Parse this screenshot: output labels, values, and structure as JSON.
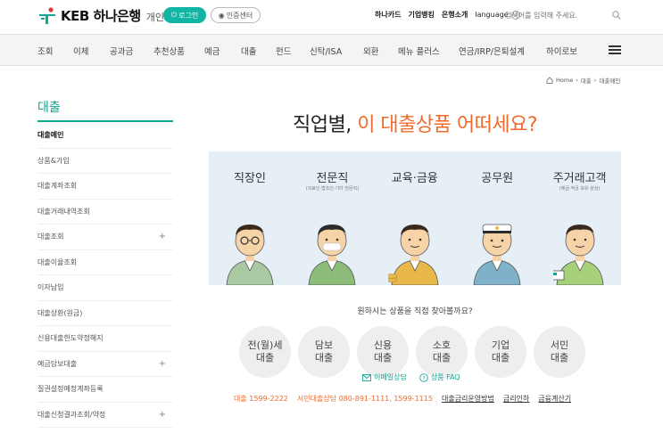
{
  "header": {
    "logo_text": "KEB 하나은행",
    "logo_sub": "개인",
    "login_label": "로그인",
    "cert_label": "인증센터",
    "util_links": [
      "하나카드",
      "기업뱅킹",
      "은행소개"
    ],
    "language_label": "language",
    "search_placeholder": "검색어를 입력해 주세요."
  },
  "nav": {
    "items": [
      "조회",
      "이체",
      "공과금",
      "추천상품",
      "예금",
      "대출",
      "펀드",
      "신탁/ISA",
      "외환",
      "메뉴 플러스",
      "연금/IRP/은퇴설계",
      "하이로보"
    ]
  },
  "breadcrumb": [
    "Home",
    "대출",
    "대출메인"
  ],
  "sidebar": {
    "title": "대출",
    "items": [
      {
        "label": "대출메인",
        "active": true,
        "expand": false
      },
      {
        "label": "상품&가입",
        "active": false,
        "expand": false
      },
      {
        "label": "대출계좌조회",
        "active": false,
        "expand": false
      },
      {
        "label": "대출거래내역조회",
        "active": false,
        "expand": false
      },
      {
        "label": "대출조회",
        "active": false,
        "expand": true
      },
      {
        "label": "대출이율조회",
        "active": false,
        "expand": false
      },
      {
        "label": "이자납입",
        "active": false,
        "expand": false
      },
      {
        "label": "대출상환(원금)",
        "active": false,
        "expand": false
      },
      {
        "label": "신용대출한도약정해지",
        "active": false,
        "expand": false
      },
      {
        "label": "예금담보대출",
        "active": false,
        "expand": true
      },
      {
        "label": "질권설정예정계좌등록",
        "active": false,
        "expand": false
      },
      {
        "label": "대출신청결과조회/약정",
        "active": false,
        "expand": true
      }
    ]
  },
  "main": {
    "headline_prefix": "직업별,",
    "headline_accent": "이 대출상품 어떠세요?",
    "personas": [
      {
        "name": "직장인",
        "sub": ""
      },
      {
        "name": "전문직",
        "sub": "(의료인·법조인·기타 전문직)"
      },
      {
        "name": "교육·금융",
        "sub": ""
      },
      {
        "name": "공무원",
        "sub": ""
      },
      {
        "name": "주거래고객",
        "sub": "(예금·적금 보유 관심)"
      }
    ],
    "question": "원하시는 상품을 직접 찾아볼까요?",
    "categories": [
      {
        "line1": "전(월)세",
        "line2": "대출"
      },
      {
        "line1": "담보",
        "line2": "대출"
      },
      {
        "line1": "신용",
        "line2": "대출"
      },
      {
        "line1": "소호",
        "line2": "대출"
      },
      {
        "line1": "기업",
        "line2": "대출"
      },
      {
        "line1": "서민",
        "line2": "대출"
      }
    ],
    "email_consult": "이메일상담",
    "faq": "상품 FAQ",
    "contact_loan": "대출 1599-2222",
    "contact_seomin": "서민대출상담 080-891-1111, 1599-1115",
    "contact_links": [
      "대출금리운영방법",
      "금리인하",
      "금융계산기"
    ]
  },
  "colors": {
    "accent": "#12a594",
    "orange": "#ef6b2d",
    "banner": "#e6eff6"
  }
}
